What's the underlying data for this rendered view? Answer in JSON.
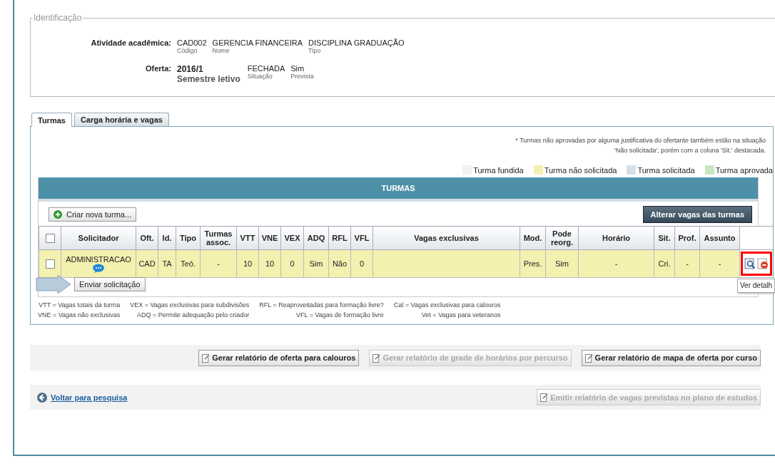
{
  "identificacao": {
    "legend": "Identificação",
    "atividade": {
      "label": "Atividade acadêmica:",
      "fields": [
        {
          "value": "CAD002",
          "caption": "Código"
        },
        {
          "value": "GERENCIA FINANCEIRA",
          "caption": "Nome"
        },
        {
          "value": "DISCIPLINA GRADUAÇÃO",
          "caption": "Tipo"
        }
      ]
    },
    "oferta": {
      "label": "Oferta:",
      "period": "2016/1",
      "period_caption": "Semestre letivo",
      "fields": [
        {
          "value": "FECHADA",
          "caption": "Situação"
        },
        {
          "value": "Sim",
          "caption": "Prevista"
        }
      ]
    }
  },
  "tabs": [
    {
      "label": "Turmas",
      "selected": true
    },
    {
      "label": "Carga horária e vagas",
      "selected": false
    }
  ],
  "note": [
    "* Turmas não aprovadas por alguma justificativa do ofertante também estão na situação",
    "'Não solicitada', porém com a coluna 'Sit.' destacada."
  ],
  "legend": [
    {
      "label": "Turma fundida",
      "color": "#f2f2f2"
    },
    {
      "label": "Turma não solicitada",
      "color": "#f4f0b0"
    },
    {
      "label": "Turma solicitada",
      "color": "#d6dfe8"
    },
    {
      "label": "Turma aprovada",
      "color": "#c6e6c0"
    }
  ],
  "table": {
    "title": "TURMAS",
    "new_button": "Criar nova turma...",
    "alter_button": "Alterar vagas das turmas",
    "header_checked": false,
    "columns": [
      "Solicitador",
      "Oft.",
      "Id.",
      "Tipo",
      "Turmas assoc.",
      "VTT",
      "VNE",
      "VEX",
      "ADQ",
      "RFL",
      "VFL",
      "Vagas exclusivas",
      "Mod.",
      "Pode reorg.",
      "Horário",
      "Sit.",
      "Prof.",
      "Assunto"
    ],
    "rows": [
      {
        "checked": false,
        "color": "#f4f0b0",
        "cells": [
          "ADMINISTRACAO",
          "CAD",
          "TA",
          "Teó.",
          "-",
          "10",
          "10",
          "0",
          "Sim",
          "Não",
          "0",
          "",
          "Pres.",
          "Sim",
          "-",
          "Cri.",
          "-",
          "-"
        ]
      }
    ],
    "send_button": "Enviar solicitação",
    "tooltip": "Ver detalh"
  },
  "glossary": [
    "VTT = Vagas totais da turma",
    "VEX = Vagas exclusivas para subdivisões",
    "RFL = Reaproveitadas para formação livre?",
    "Cal = Vagas exclusivas para calouros",
    "VNE = Vagas não exclusivas",
    "ADQ = Permite adequação pelo criador",
    "VFL = Vagas de formação livre",
    "Vet = Vagas para veteranos"
  ],
  "reports": [
    {
      "label": "Gerar relatório de oferta para calouros",
      "disabled": false
    },
    {
      "label": "Gerar relatório de grade de horários por percurso",
      "disabled": true
    },
    {
      "label": "Gerar relatório de mapa de oferta por curso",
      "disabled": false
    }
  ],
  "back_link": "Voltar para pesquisa",
  "emit_button": {
    "label": "Emitir relatório de vagas previstas no plano de estudos",
    "disabled": true
  }
}
